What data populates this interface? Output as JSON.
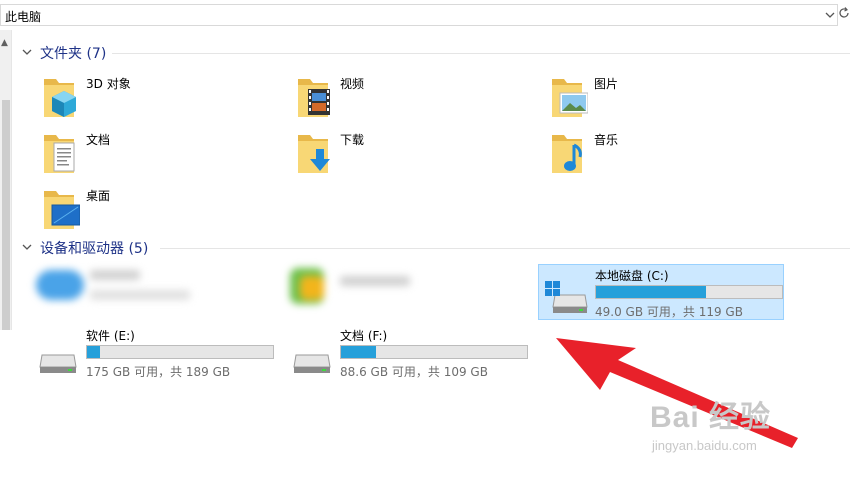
{
  "address": {
    "path": "此电脑",
    "dropdown_icon": "chevron-down-icon",
    "refresh_icon": "refresh-icon"
  },
  "groups": {
    "folders": {
      "title": "文件夹 (7)"
    },
    "devices": {
      "title": "设备和驱动器 (5)"
    }
  },
  "folders": [
    {
      "label": "3D 对象",
      "icon": "3d-objects-folder-icon"
    },
    {
      "label": "视频",
      "icon": "videos-folder-icon"
    },
    {
      "label": "图片",
      "icon": "pictures-folder-icon"
    },
    {
      "label": "文档",
      "icon": "documents-folder-icon"
    },
    {
      "label": "下载",
      "icon": "downloads-folder-icon"
    },
    {
      "label": "音乐",
      "icon": "music-folder-icon"
    },
    {
      "label": "桌面",
      "icon": "desktop-folder-icon"
    }
  ],
  "drives": [
    {
      "name": "本地磁盘 (C:)",
      "info": "49.0 GB 可用，共 119 GB",
      "used_fraction": 0.59,
      "selected": true,
      "icon": "windows-drive-icon"
    },
    {
      "name": "软件 (E:)",
      "info": "175 GB 可用，共 189 GB",
      "used_fraction": 0.07,
      "selected": false,
      "icon": "drive-icon"
    },
    {
      "name": "文档 (F:)",
      "info": "88.6 GB 可用，共 109 GB",
      "used_fraction": 0.19,
      "selected": false,
      "icon": "drive-icon"
    }
  ],
  "colors": {
    "group_title": "#1e3287",
    "drive_fill": "#26a0da",
    "selection_bg": "#cce8ff",
    "arrow": "#e8212a"
  },
  "watermark": {
    "title": "Bai 经验",
    "subtitle": "jingyan.baidu.com"
  }
}
